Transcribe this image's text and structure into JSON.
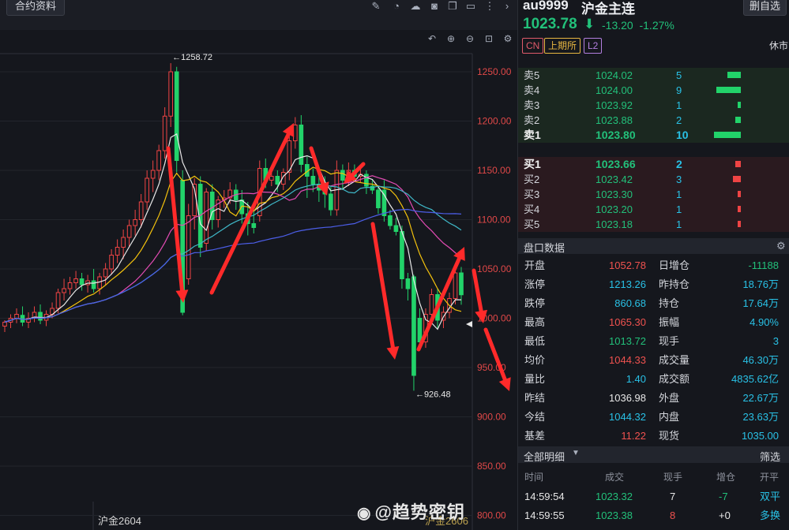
{
  "toolbar": {
    "tab_label": "合约资料"
  },
  "chart_data": {
    "type": "candlestick",
    "symbol": "au9999",
    "price_axis_ticks": [
      1250,
      1200,
      1150,
      1100,
      1050,
      1000,
      950,
      900,
      850,
      800
    ],
    "price_axis_labels": [
      "1250.00",
      "1200.00",
      "1150.00",
      "1100.00",
      "1050.00",
      "1000.00",
      "950.00",
      "900.00",
      "850.00",
      "800.00"
    ],
    "high_annotation": "1258.72",
    "low_annotation": "926.48",
    "candles": [
      {
        "o": 992,
        "h": 998,
        "c": 996,
        "l": 986
      },
      {
        "o": 996,
        "h": 1004,
        "c": 1000,
        "l": 990
      },
      {
        "o": 1000,
        "h": 1010,
        "c": 1004,
        "l": 995
      },
      {
        "o": 1003,
        "h": 1012,
        "c": 996,
        "l": 992
      },
      {
        "o": 996,
        "h": 1006,
        "c": 1000,
        "l": 990
      },
      {
        "o": 1000,
        "h": 1012,
        "c": 1006,
        "l": 996
      },
      {
        "o": 1006,
        "h": 1014,
        "c": 998,
        "l": 994
      },
      {
        "o": 998,
        "h": 1008,
        "c": 1004,
        "l": 992
      },
      {
        "o": 1004,
        "h": 1016,
        "c": 1010,
        "l": 1000
      },
      {
        "o": 1010,
        "h": 1030,
        "c": 1026,
        "l": 1005
      },
      {
        "o": 1026,
        "h": 1040,
        "c": 1030,
        "l": 1018
      },
      {
        "o": 1030,
        "h": 1042,
        "c": 1036,
        "l": 1024
      },
      {
        "o": 1036,
        "h": 1048,
        "c": 1040,
        "l": 1030
      },
      {
        "o": 1040,
        "h": 1046,
        "c": 1034,
        "l": 1028
      },
      {
        "o": 1034,
        "h": 1044,
        "c": 1038,
        "l": 1026
      },
      {
        "o": 1038,
        "h": 1050,
        "c": 1030,
        "l": 1026
      },
      {
        "o": 1030,
        "h": 1046,
        "c": 1042,
        "l": 1024
      },
      {
        "o": 1042,
        "h": 1056,
        "c": 1050,
        "l": 1034
      },
      {
        "o": 1050,
        "h": 1070,
        "c": 1064,
        "l": 1044
      },
      {
        "o": 1064,
        "h": 1080,
        "c": 1072,
        "l": 1056
      },
      {
        "o": 1072,
        "h": 1090,
        "c": 1082,
        "l": 1060
      },
      {
        "o": 1082,
        "h": 1100,
        "c": 1094,
        "l": 1072
      },
      {
        "o": 1094,
        "h": 1110,
        "c": 1100,
        "l": 1084
      },
      {
        "o": 1100,
        "h": 1126,
        "c": 1118,
        "l": 1092
      },
      {
        "o": 1118,
        "h": 1150,
        "c": 1142,
        "l": 1110
      },
      {
        "o": 1142,
        "h": 1160,
        "c": 1150,
        "l": 1128
      },
      {
        "o": 1150,
        "h": 1176,
        "c": 1170,
        "l": 1140
      },
      {
        "o": 1170,
        "h": 1214,
        "c": 1205,
        "l": 1162
      },
      {
        "o": 1205,
        "h": 1258.72,
        "c": 1250,
        "l": 1194
      },
      {
        "o": 1250,
        "h": 1255,
        "c": 1160,
        "l": 1148
      },
      {
        "o": 1140,
        "h": 1150,
        "c": 1006,
        "l": 1003
      },
      {
        "o": 1040,
        "h": 1116,
        "c": 1104,
        "l": 1034
      },
      {
        "o": 1104,
        "h": 1142,
        "c": 1136,
        "l": 1090
      },
      {
        "o": 1136,
        "h": 1144,
        "c": 1072,
        "l": 1062
      },
      {
        "o": 1076,
        "h": 1132,
        "c": 1128,
        "l": 1068
      },
      {
        "o": 1128,
        "h": 1136,
        "c": 1100,
        "l": 1090
      },
      {
        "o": 1100,
        "h": 1124,
        "c": 1120,
        "l": 1092
      },
      {
        "o": 1120,
        "h": 1130,
        "c": 1122,
        "l": 1112
      },
      {
        "o": 1122,
        "h": 1138,
        "c": 1130,
        "l": 1116
      },
      {
        "o": 1130,
        "h": 1136,
        "c": 1120,
        "l": 1110
      },
      {
        "o": 1120,
        "h": 1130,
        "c": 1106,
        "l": 1096
      },
      {
        "o": 1106,
        "h": 1118,
        "c": 1096,
        "l": 1084
      },
      {
        "o": 1096,
        "h": 1110,
        "c": 1092,
        "l": 1086
      },
      {
        "o": 1104,
        "h": 1160,
        "c": 1152,
        "l": 1098
      },
      {
        "o": 1152,
        "h": 1162,
        "c": 1140,
        "l": 1132
      },
      {
        "o": 1140,
        "h": 1152,
        "c": 1144,
        "l": 1134
      },
      {
        "o": 1144,
        "h": 1150,
        "c": 1136,
        "l": 1128
      },
      {
        "o": 1136,
        "h": 1152,
        "c": 1148,
        "l": 1130
      },
      {
        "o": 1148,
        "h": 1186,
        "c": 1180,
        "l": 1140
      },
      {
        "o": 1180,
        "h": 1204,
        "c": 1196,
        "l": 1172
      },
      {
        "o": 1196,
        "h": 1206,
        "c": 1156,
        "l": 1148
      },
      {
        "o": 1156,
        "h": 1164,
        "c": 1144,
        "l": 1122
      },
      {
        "o": 1144,
        "h": 1152,
        "c": 1136,
        "l": 1128
      },
      {
        "o": 1136,
        "h": 1150,
        "c": 1130,
        "l": 1118
      },
      {
        "o": 1130,
        "h": 1144,
        "c": 1126,
        "l": 1112
      },
      {
        "o": 1126,
        "h": 1134,
        "c": 1110,
        "l": 1104
      },
      {
        "o": 1110,
        "h": 1160,
        "c": 1150,
        "l": 1104
      },
      {
        "o": 1150,
        "h": 1156,
        "c": 1140,
        "l": 1130
      },
      {
        "o": 1140,
        "h": 1158,
        "c": 1150,
        "l": 1134
      },
      {
        "o": 1150,
        "h": 1156,
        "c": 1144,
        "l": 1138
      },
      {
        "o": 1144,
        "h": 1152,
        "c": 1146,
        "l": 1138
      },
      {
        "o": 1146,
        "h": 1150,
        "c": 1134,
        "l": 1126
      },
      {
        "o": 1134,
        "h": 1140,
        "c": 1130,
        "l": 1126
      },
      {
        "o": 1130,
        "h": 1134,
        "c": 1112,
        "l": 1106
      },
      {
        "o": 1130,
        "h": 1140,
        "c": 1104,
        "l": 1098
      },
      {
        "o": 1104,
        "h": 1110,
        "c": 1094,
        "l": 1090
      },
      {
        "o": 1094,
        "h": 1102,
        "c": 1088,
        "l": 1084
      },
      {
        "o": 1088,
        "h": 1094,
        "c": 1040,
        "l": 1030
      },
      {
        "o": 1040,
        "h": 1046,
        "c": 1030,
        "l": 1018
      },
      {
        "o": 1042,
        "h": 1044,
        "c": 942,
        "l": 926.48
      },
      {
        "o": 1000,
        "h": 1010,
        "c": 976,
        "l": 968
      },
      {
        "o": 976,
        "h": 1010,
        "c": 1004,
        "l": 970
      },
      {
        "o": 1004,
        "h": 1030,
        "c": 1024,
        "l": 996
      },
      {
        "o": 1024,
        "h": 1030,
        "c": 998,
        "l": 990
      },
      {
        "o": 998,
        "h": 1012,
        "c": 1006,
        "l": 990
      },
      {
        "o": 1006,
        "h": 1026,
        "c": 1020,
        "l": 1000
      },
      {
        "o": 1020,
        "h": 1050,
        "c": 1046,
        "l": 1014
      },
      {
        "o": 1046,
        "h": 1052,
        "c": 1023.78,
        "l": 1013.72
      }
    ]
  },
  "bottom": {
    "contract_label": "沪金2604",
    "contract_label2": "沪金2606"
  },
  "watermark": {
    "text": "@趋势密钥"
  },
  "quote": {
    "code": "au9999",
    "name": "沪金主连",
    "button": "删自选",
    "price": "1023.78",
    "change": "-13.20",
    "change_pct": "-1.27%",
    "badge_cn": "CN",
    "badge_exchange": "上期所",
    "badge_level": "L2",
    "status": "休市",
    "asks": [
      {
        "label": "卖5",
        "price": "1024.02",
        "vol": "5",
        "bar": 0.5
      },
      {
        "label": "卖4",
        "price": "1024.00",
        "vol": "9",
        "bar": 0.9
      },
      {
        "label": "卖3",
        "price": "1023.92",
        "vol": "1",
        "bar": 0.1
      },
      {
        "label": "卖2",
        "price": "1023.88",
        "vol": "2",
        "bar": 0.2
      },
      {
        "label": "卖1",
        "price": "1023.80",
        "vol": "10",
        "bar": 1.0
      }
    ],
    "bids": [
      {
        "label": "买1",
        "price": "1023.66",
        "vol": "2",
        "bar": 0.2
      },
      {
        "label": "买2",
        "price": "1023.42",
        "vol": "3",
        "bar": 0.3
      },
      {
        "label": "买3",
        "price": "1023.30",
        "vol": "1",
        "bar": 0.1
      },
      {
        "label": "买4",
        "price": "1023.20",
        "vol": "1",
        "bar": 0.1
      },
      {
        "label": "买5",
        "price": "1023.18",
        "vol": "1",
        "bar": 0.1
      }
    ],
    "stats_title": "盘口数据",
    "stats": [
      {
        "l1": "开盘",
        "v1": "1052.78",
        "c1": "#f0524f",
        "l2": "日增仓",
        "v2": "-11188",
        "c2": "#22c07a"
      },
      {
        "l1": "涨停",
        "v1": "1213.26",
        "c1": "#29c1e6",
        "l2": "昨持仓",
        "v2": "18.76万",
        "c2": "#29c1e6"
      },
      {
        "l1": "跌停",
        "v1": "860.68",
        "c1": "#29c1e6",
        "l2": "持仓",
        "v2": "17.64万",
        "c2": "#29c1e6"
      },
      {
        "l1": "最高",
        "v1": "1065.30",
        "c1": "#f0524f",
        "l2": "振幅",
        "v2": "4.90%",
        "c2": "#29c1e6"
      },
      {
        "l1": "最低",
        "v1": "1013.72",
        "c1": "#22c07a",
        "l2": "现手",
        "v2": "3",
        "c2": "#29c1e6"
      },
      {
        "l1": "均价",
        "v1": "1044.33",
        "c1": "#f0524f",
        "l2": "成交量",
        "v2": "46.30万",
        "c2": "#29c1e6"
      },
      {
        "l1": "量比",
        "v1": "1.40",
        "c1": "#29c1e6",
        "l2": "成交额",
        "v2": "4835.62亿",
        "c2": "#29c1e6"
      },
      {
        "l1": "昨结",
        "v1": "1036.98",
        "c1": "#e8e8e8",
        "l2": "外盘",
        "v2": "22.67万",
        "c2": "#29c1e6"
      },
      {
        "l1": "今结",
        "v1": "1044.32",
        "c1": "#29c1e6",
        "l2": "内盘",
        "v2": "23.63万",
        "c2": "#29c1e6"
      },
      {
        "l1": "基差",
        "v1": "11.22",
        "c1": "#f0524f",
        "l2": "现货",
        "v2": "1035.00",
        "c2": "#29c1e6"
      }
    ],
    "detail_title": "全部明细",
    "filter_label": "筛选",
    "columns": [
      "时间",
      "成交",
      "现手",
      "增仓",
      "开平"
    ],
    "trades": [
      {
        "time": "14:59:54",
        "price": "1023.32",
        "vol": "7",
        "oi": "-7",
        "type": "双平",
        "vol_color": "#e8e8e8",
        "oi_color": "#22c07a",
        "type_color": "#29c1e6"
      },
      {
        "time": "14:59:55",
        "price": "1023.38",
        "vol": "8",
        "oi": "+0",
        "type": "多换",
        "vol_color": "#f0524f",
        "oi_color": "#e8e8e8",
        "type_color": "#29c1e6"
      }
    ]
  }
}
